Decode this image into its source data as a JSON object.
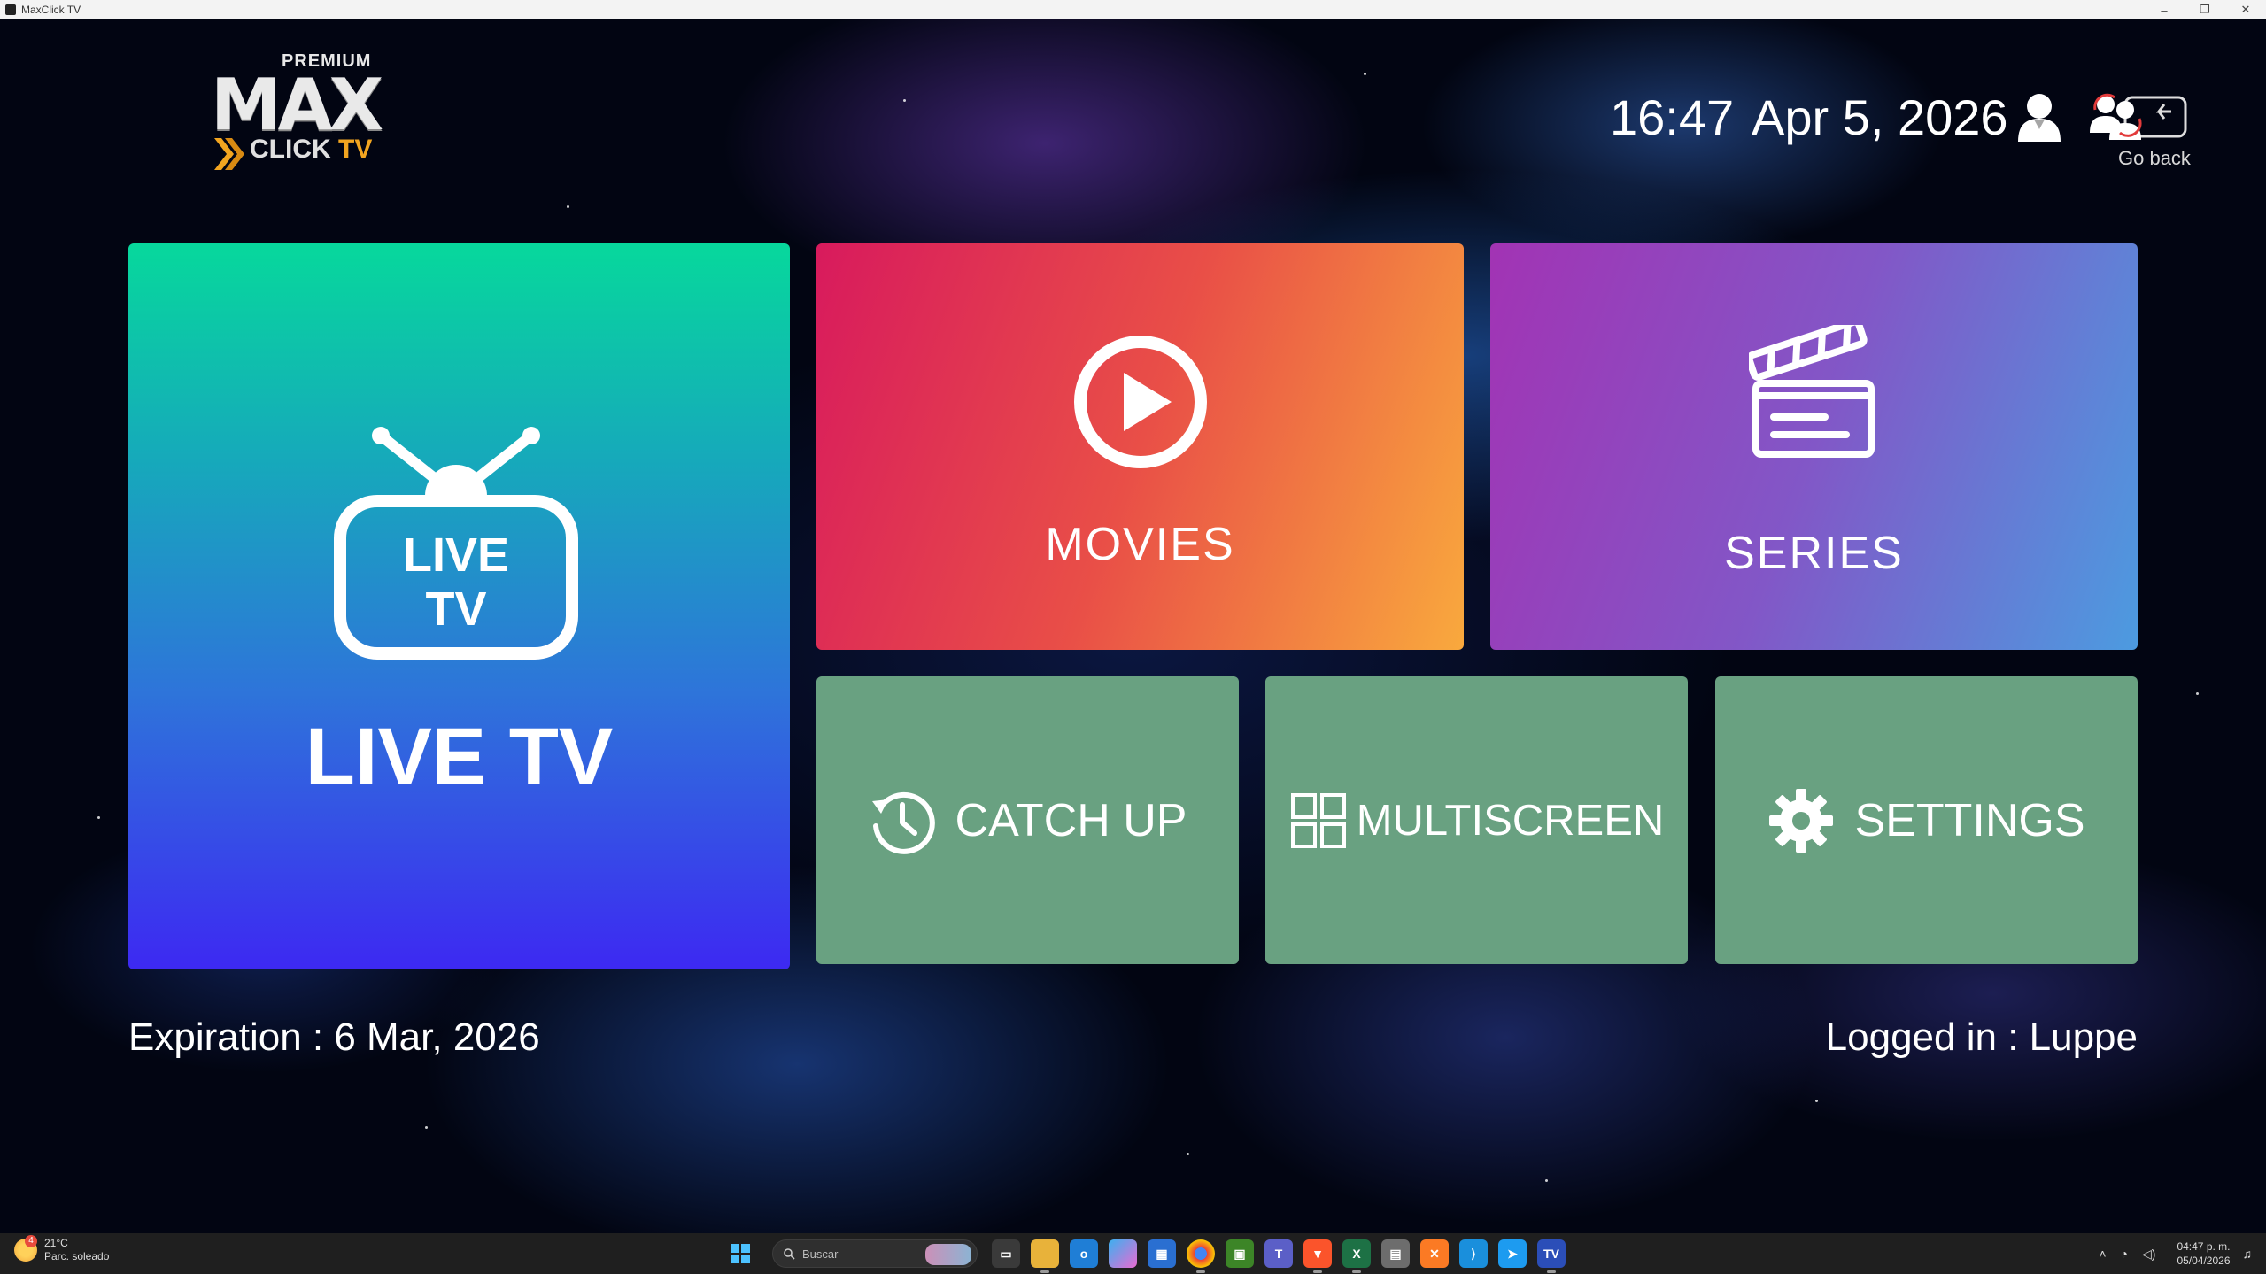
{
  "window": {
    "title": "MaxClick TV",
    "controls": {
      "minimize": "–",
      "restore": "❐",
      "close": "✕"
    }
  },
  "logo": {
    "premium": "PREMIUM",
    "max": "MAX",
    "click": "CLICK",
    "tv": "TV"
  },
  "header": {
    "time": "16:47",
    "date": "Apr 5, 2026",
    "user_icon": "user-icon",
    "goback_icon": "go-back-icon",
    "goback_label": "Go back"
  },
  "tiles": {
    "live_tv": {
      "icon_text_line1": "LIVE",
      "icon_text_line2": "TV",
      "label": "LIVE TV",
      "icon": "tv-antenna-icon"
    },
    "movies": {
      "label": "MOVIES",
      "icon": "play-circle-icon"
    },
    "series": {
      "label": "SERIES",
      "icon": "clapperboard-icon"
    },
    "catch_up": {
      "label": "CATCH UP",
      "icon": "history-clock-icon"
    },
    "multiscreen": {
      "label": "MULTISCREEN",
      "icon": "grid-icon"
    },
    "settings": {
      "label": "SETTINGS",
      "icon": "gear-icon"
    }
  },
  "footer": {
    "expiration": "Expiration : 6 Mar, 2026",
    "logged_in": "Logged in : Luppe"
  },
  "colors": {
    "live_tv_top": "#07d89c",
    "live_tv_bottom": "#3d29f2",
    "movies_left": "#d81a5d",
    "movies_right": "#f9a93d",
    "series_left": "#a233b4",
    "series_right": "#4c9be0",
    "small_tile": "#69a181",
    "logo_accent": "#f2a520"
  },
  "taskbar": {
    "weather_temp": "21°C",
    "weather_desc": "Parc. soleado",
    "weather_badge": "4",
    "search_placeholder": "Buscar",
    "tray_time": "04:47 p. m.",
    "tray_date": "05/04/2026"
  }
}
